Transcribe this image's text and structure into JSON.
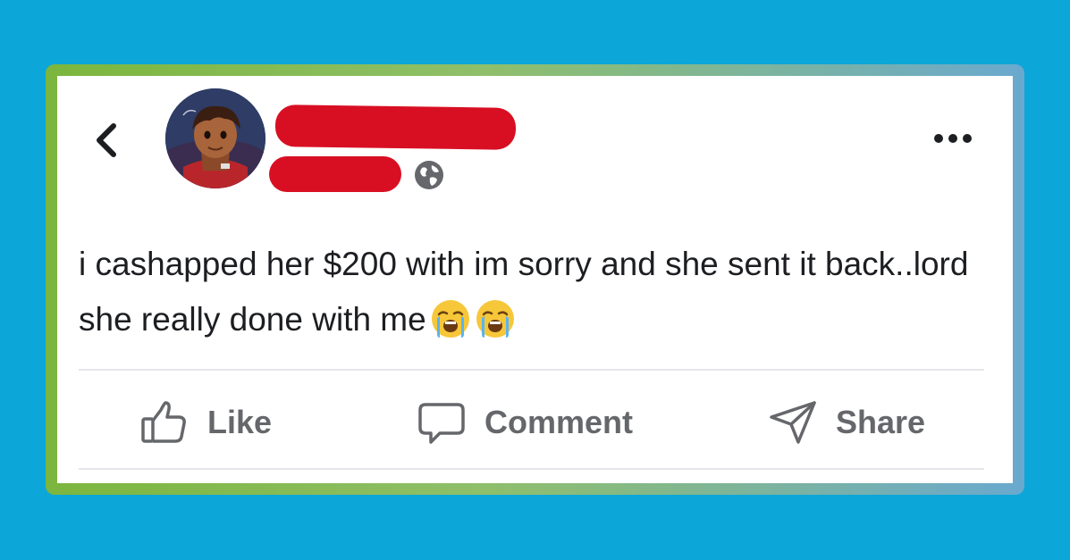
{
  "post": {
    "text": "i cashapped her $200 with im sorry and she sent it back..lord she really done with me",
    "emojis": [
      "loudly-crying-face-icon",
      "loudly-crying-face-icon"
    ]
  },
  "header": {
    "back_icon": "chevron-left-icon",
    "privacy_icon": "globe-icon",
    "more_icon": "more-horizontal-icon"
  },
  "actions": {
    "like": "Like",
    "comment": "Comment",
    "share": "Share"
  },
  "colors": {
    "background": "#0ca6d8",
    "redaction": "#d80f23",
    "action_text": "#65676b"
  }
}
